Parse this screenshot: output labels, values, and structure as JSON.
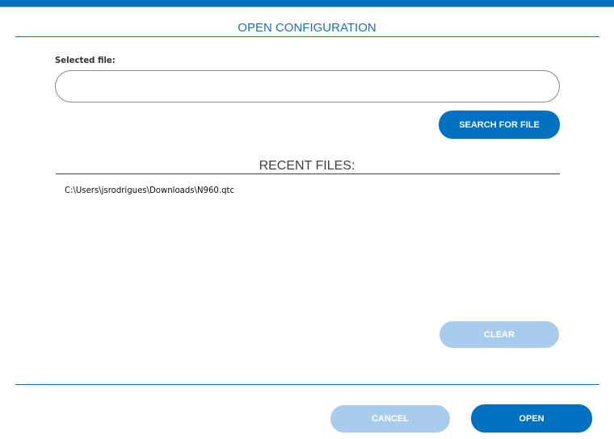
{
  "dialog": {
    "title": "OPEN CONFIGURATION"
  },
  "selected_file": {
    "label": "Selected file:",
    "value": ""
  },
  "search_button": "SEARCH FOR FILE",
  "recent": {
    "heading": "RECENT FILES:",
    "files": [
      "C:\\Users\\jsrodrigues\\Downloads\\N960.qtc"
    ]
  },
  "clear_button": "CLEAR",
  "footer": {
    "cancel": "CANCEL",
    "open": "OPEN"
  },
  "colors": {
    "primary": "#0070c0",
    "disabled": "#a8cdec"
  }
}
